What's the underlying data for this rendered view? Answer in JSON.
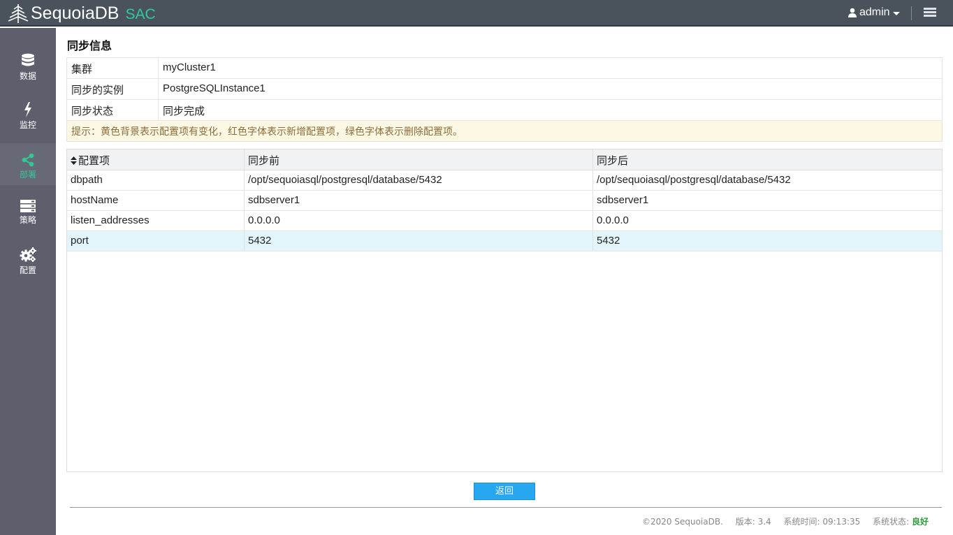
{
  "header": {
    "brand": "SequoiaDB",
    "product": "SAC",
    "user": "admin"
  },
  "sidebar": {
    "items": [
      {
        "label": "数据",
        "icon": "database-icon"
      },
      {
        "label": "监控",
        "icon": "lightning-icon"
      },
      {
        "label": "部署",
        "icon": "share-icon",
        "active": true
      },
      {
        "label": "策略",
        "icon": "server-rack-icon"
      },
      {
        "label": "配置",
        "icon": "gears-icon"
      }
    ]
  },
  "page": {
    "title": "同步信息"
  },
  "info": {
    "rows": [
      {
        "key": "集群",
        "value": "myCluster1"
      },
      {
        "key": "同步的实例",
        "value": "PostgreSQLInstance1"
      },
      {
        "key": "同步状态",
        "value": "同步完成"
      }
    ],
    "tip": "提示：黄色背景表示配置项有变化，红色字体表示新增配置项，绿色字体表示删除配置项。"
  },
  "grid": {
    "headers": [
      "配置项",
      "同步前",
      "同步后"
    ],
    "rows": [
      [
        "dbpath",
        "/opt/sequoiasql/postgresql/database/5432",
        "/opt/sequoiasql/postgresql/database/5432"
      ],
      [
        "hostName",
        "sdbserver1",
        "sdbserver1"
      ],
      [
        "listen_addresses",
        "0.0.0.0",
        "0.0.0.0"
      ],
      [
        "port",
        "5432",
        "5432"
      ]
    ]
  },
  "actions": {
    "back_label": "返回"
  },
  "footer": {
    "copyright": "©2020 SequoiaDB.",
    "version": "版本: 3.4",
    "time": "系统时间: 09:13:35",
    "status_label": "系统状态:",
    "status_value": "良好"
  },
  "colors": {
    "accent": "#32c896",
    "topbar": "#4a525c",
    "sidebar": "#5e5f6d",
    "button": "#27a7f0",
    "tip_bg": "#fcf8e3",
    "highlight_row": "#e2f5fb"
  }
}
